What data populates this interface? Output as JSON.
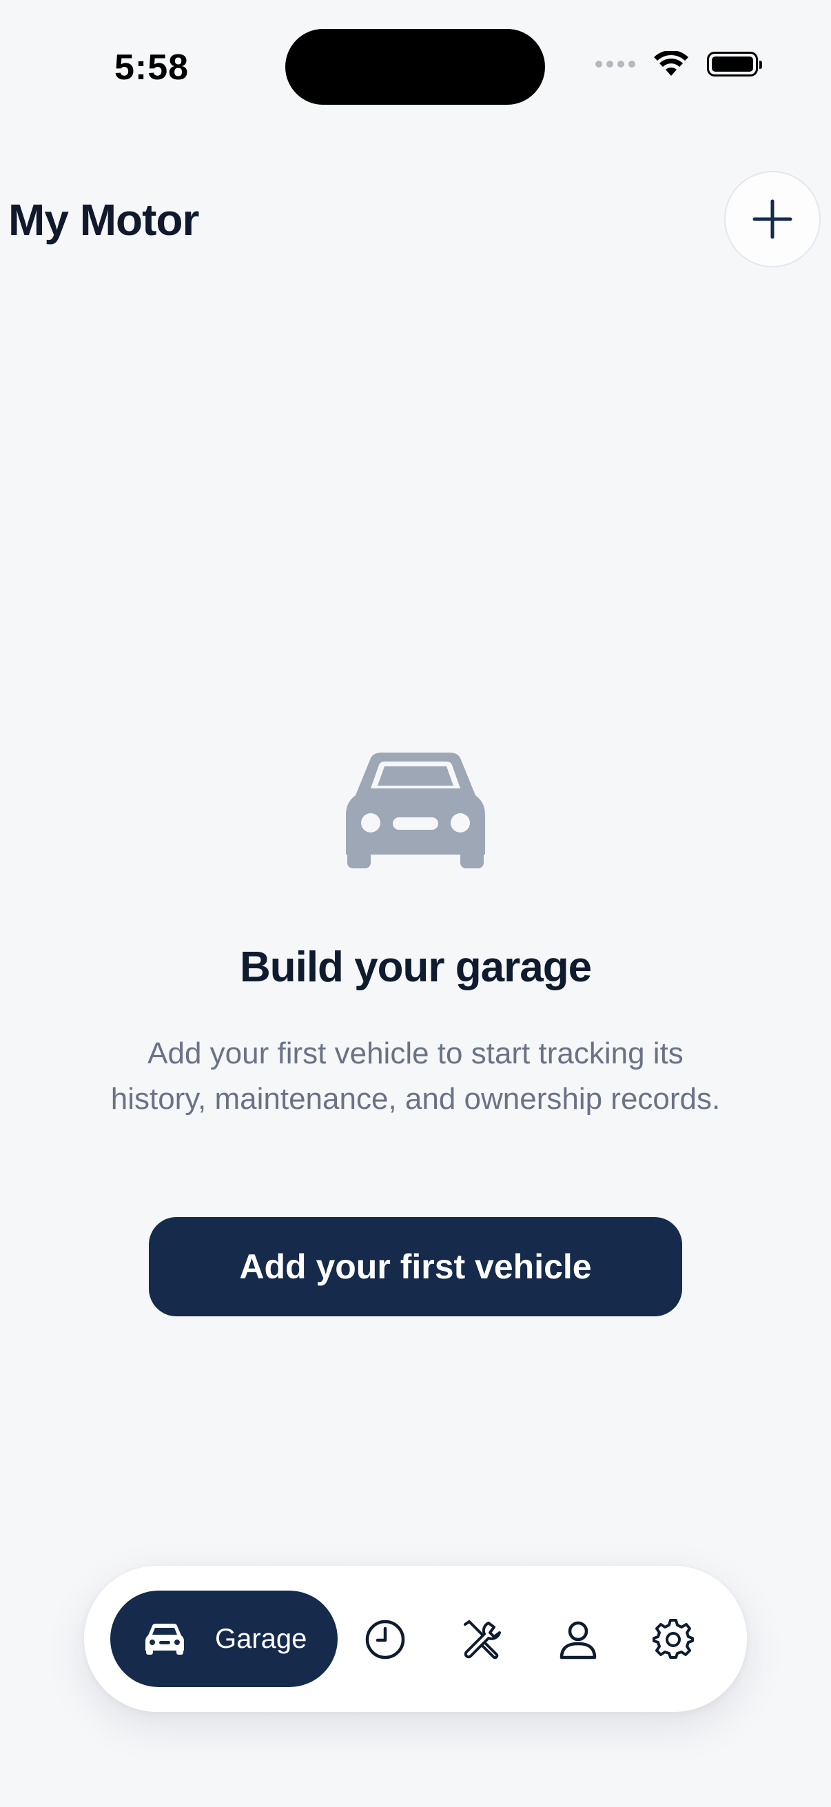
{
  "status_bar": {
    "time": "5:58"
  },
  "header": {
    "title": "My Motor",
    "add_icon": "plus-icon"
  },
  "empty_state": {
    "icon": "car-icon",
    "title": "Build your garage",
    "description": "Add your first vehicle to start tracking its history, maintenance, and ownership records.",
    "button_label": "Add your first vehicle"
  },
  "tab_bar": {
    "active_tab": {
      "label": "Garage",
      "icon": "car-icon"
    },
    "tabs": [
      {
        "icon": "clock-icon"
      },
      {
        "icon": "tools-icon"
      },
      {
        "icon": "person-icon"
      },
      {
        "icon": "gear-icon"
      }
    ]
  },
  "colors": {
    "background": "#f6f7f9",
    "primary": "#162a4b",
    "title_text": "#0f1b2e",
    "secondary_text": "#6a7385",
    "icon_muted": "#9ea7b6"
  }
}
